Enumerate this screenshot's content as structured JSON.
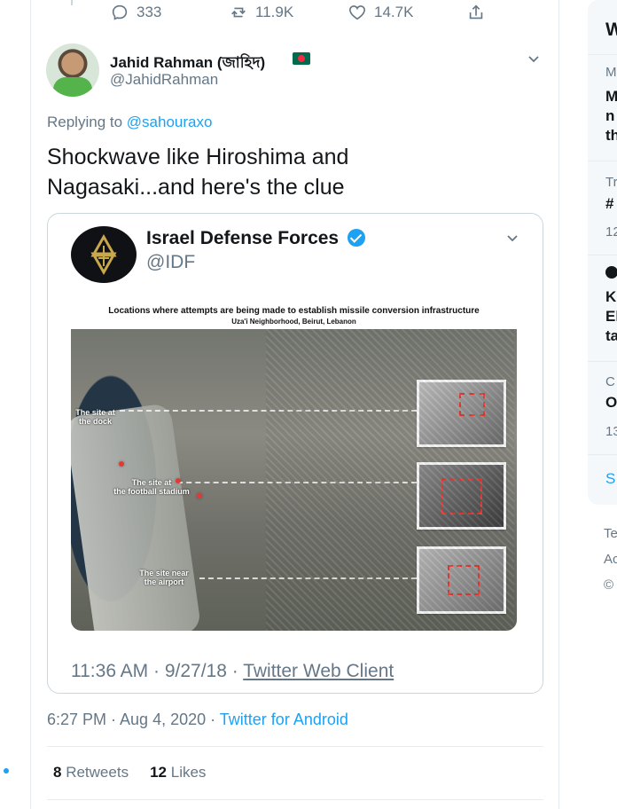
{
  "top_actions": [
    {
      "name": "reply-icon",
      "count": "333"
    },
    {
      "name": "retweet-icon",
      "count": "11.9K"
    },
    {
      "name": "like-icon",
      "count": "14.7K"
    },
    {
      "name": "share-icon",
      "count": ""
    }
  ],
  "tweet": {
    "author": "Jahid Rahman (জাহিদ)",
    "handle": "@JahidRahman",
    "replying_prefix": "Replying to ",
    "replying_to": "@sahouraxo",
    "text_line1": "Shockwave like Hiroshima and",
    "text_line2": "Nagasaki...and here's the clue",
    "time": "6:27 PM · Aug 4, 2020",
    "separator": " · ",
    "client": "Twitter for Android",
    "retweets_count": "8",
    "retweets_label": "Retweets",
    "likes_count": "12",
    "likes_label": "Likes"
  },
  "quote": {
    "author": "Israel Defense Forces",
    "handle": "@IDF",
    "image_title": "Locations where attempts are being made to establish missile conversion infrastructure",
    "image_subtitle": "Uza'i Neighborhood, Beirut, Lebanon",
    "labels": {
      "dock_line1": "The site at",
      "dock_line2": "the dock",
      "stadium_line1": "The site at",
      "stadium_line2": "the football stadium",
      "airport_line1": "The site near",
      "airport_line2": "the airport"
    },
    "time": "11:36 AM · 9/27/18",
    "separator": " · ",
    "client": "Twitter Web Client"
  },
  "sidebar": {
    "top_letter": "W",
    "items": [
      {
        "muted": "M",
        "lines": [
          "M",
          "n",
          "th"
        ]
      },
      {
        "muted": "Tr",
        "lines": [
          "#"
        ],
        "count": "12"
      },
      {
        "muted": "",
        "lines": [
          "K",
          "El",
          "ta"
        ]
      },
      {
        "muted": "C",
        "lines": [
          "O"
        ],
        "count": "13"
      }
    ],
    "link": "S",
    "footer": [
      "Te",
      "Ac",
      "©"
    ]
  },
  "colors": {
    "twitter_blue": "#1da1f2",
    "muted": "#657786",
    "border": "#e6ecf0",
    "dark": "#14171a",
    "flag_green": "#006a4e",
    "flag_red": "#f42a41",
    "verified": "#1da1f2",
    "map_marker": "#e03a34"
  }
}
